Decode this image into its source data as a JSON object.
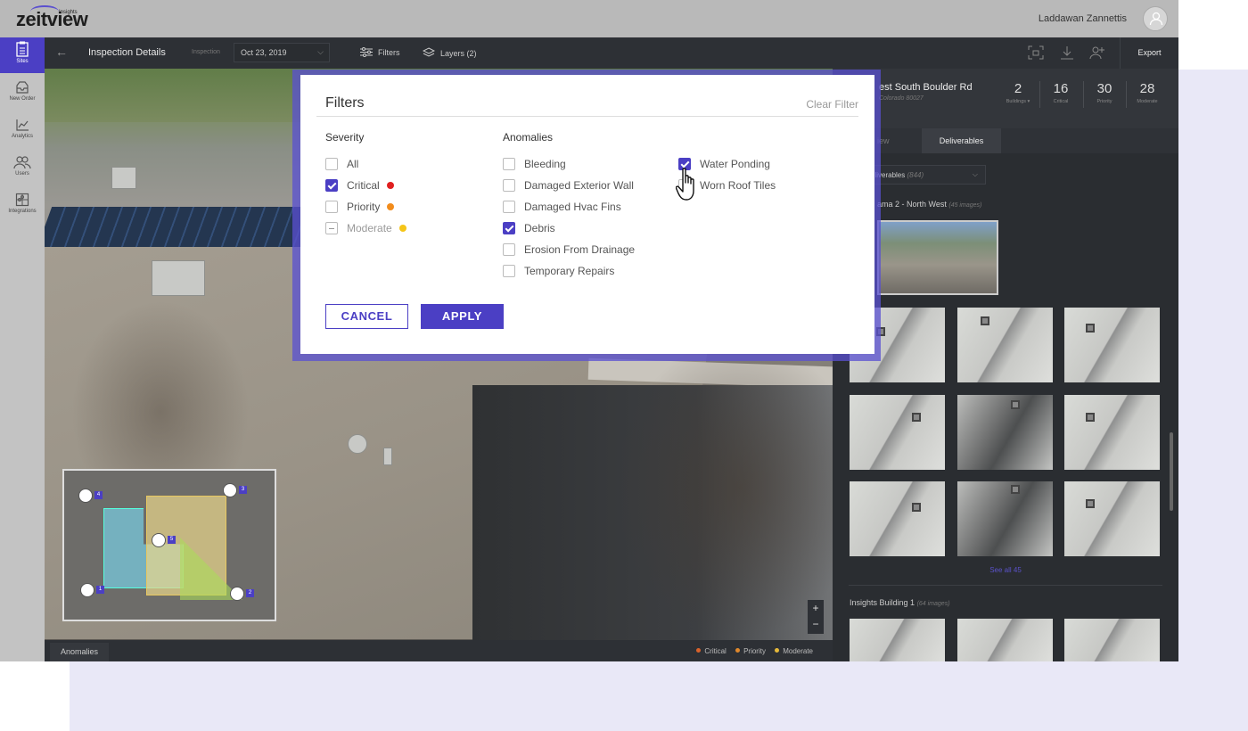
{
  "app": {
    "logo": "zeitview",
    "logo_sub": "Insights",
    "user_name": "Laddawan Zannettis"
  },
  "nav": {
    "items": [
      {
        "label": "Sites",
        "icon": "clipboard-icon"
      },
      {
        "label": "New Order",
        "icon": "inbox-icon"
      },
      {
        "label": "Analytics",
        "icon": "chart-icon"
      },
      {
        "label": "Users",
        "icon": "users-icon"
      },
      {
        "label": "Integrations",
        "icon": "puzzle-icon"
      }
    ]
  },
  "toolbar": {
    "title": "Inspection Details",
    "inspection_label": "Inspection",
    "inspection_date": "Oct 23, 2019",
    "filters_label": "Filters",
    "layers_label": "Layers (2)",
    "export_label": "Export"
  },
  "site": {
    "address": "est South Boulder Rd",
    "city": "Colorado 80027",
    "stats": [
      {
        "value": "2",
        "label": "Buildings ▾"
      },
      {
        "value": "16",
        "label": "Critical"
      },
      {
        "value": "30",
        "label": "Priority"
      },
      {
        "value": "28",
        "label": "Moderate"
      }
    ]
  },
  "right_panel": {
    "tabs": [
      "iew",
      "Deliverables"
    ],
    "select_label": "eliverables",
    "select_count": "(844)",
    "section1_title": "ama 2 - North West",
    "section1_count": "(45 images)",
    "see_all": "See all 45",
    "section2_title": "Insights Building 1",
    "section2_count": "(64 images)"
  },
  "map": {
    "pins": [
      "4",
      "3",
      "5",
      "1",
      "2"
    ],
    "zoom_in": "+",
    "zoom_out": "−"
  },
  "bottom": {
    "tab": "Anomalies",
    "legend": [
      {
        "label": "Critical",
        "color": "#d9622b"
      },
      {
        "label": "Priority",
        "color": "#e0882c"
      },
      {
        "label": "Moderate",
        "color": "#e6b93a"
      }
    ]
  },
  "filters_modal": {
    "title": "Filters",
    "clear": "Clear Filter",
    "severity_head": "Severity",
    "anomalies_head": "Anomalies",
    "severity": [
      {
        "label": "All",
        "state": "unchecked",
        "dot": ""
      },
      {
        "label": "Critical",
        "state": "checked",
        "dot": "#e02020"
      },
      {
        "label": "Priority",
        "state": "unchecked",
        "dot": "#f28c1c"
      },
      {
        "label": "Moderate",
        "state": "partial",
        "dot": "#f5c518"
      }
    ],
    "anomalies_col1": [
      {
        "label": "Bleeding",
        "state": "unchecked"
      },
      {
        "label": "Damaged Exterior Wall",
        "state": "unchecked"
      },
      {
        "label": "Damaged Hvac Fins",
        "state": "unchecked"
      },
      {
        "label": "Debris",
        "state": "checked"
      },
      {
        "label": "Erosion From Drainage",
        "state": "unchecked"
      },
      {
        "label": "Temporary Repairs",
        "state": "unchecked"
      }
    ],
    "anomalies_col2": [
      {
        "label": "Water Ponding",
        "state": "checked"
      },
      {
        "label": "Worn Roof Tiles",
        "state": "unchecked"
      }
    ],
    "cancel": "CANCEL",
    "apply": "APPLY"
  }
}
